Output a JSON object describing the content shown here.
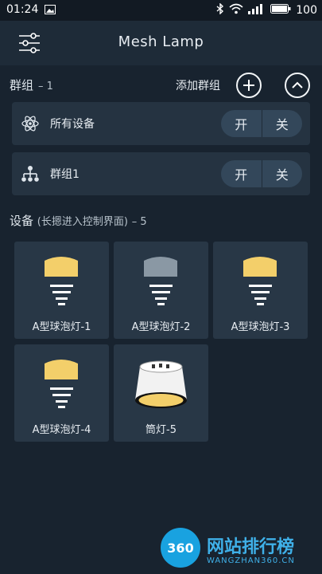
{
  "status_bar": {
    "time": "01:24",
    "battery": "100",
    "icons": [
      "image-icon",
      "bluetooth-icon",
      "wifi-icon",
      "signal-icon",
      "battery-icon"
    ]
  },
  "app_bar": {
    "title": "Mesh Lamp",
    "menu_icon": "sliders-menu-icon"
  },
  "groups": {
    "title": "群组",
    "count": "– 1",
    "add_label": "添加群组",
    "rows": [
      {
        "label": "所有设备",
        "icon": "atom-icon",
        "on": "开",
        "off": "关"
      },
      {
        "label": "群组1",
        "icon": "hierarchy-icon",
        "on": "开",
        "off": "关"
      }
    ]
  },
  "devices": {
    "title": "设备",
    "subtitle": "(长摁进入控制界面)",
    "count": "– 5",
    "items": [
      {
        "name": "A型球泡灯-1",
        "type": "bulb",
        "state": "on",
        "color": "#f3cf6a"
      },
      {
        "name": "A型球泡灯-2",
        "type": "bulb",
        "state": "off",
        "color": "#8a98a4"
      },
      {
        "name": "A型球泡灯-3",
        "type": "bulb",
        "state": "on",
        "color": "#f3cf6a"
      },
      {
        "name": "A型球泡灯-4",
        "type": "bulb",
        "state": "on",
        "color": "#f3cf6a"
      },
      {
        "name": "筒灯-5",
        "type": "downlight",
        "state": "on",
        "color": "#f3cf6a"
      }
    ]
  },
  "watermark": {
    "logo": "360",
    "title": "网站排行榜",
    "url": "WANGZHAN360.CN"
  },
  "colors": {
    "background": "#18232f",
    "card": "#253341",
    "accent_on": "#f3cf6a",
    "accent_off": "#8a98a4"
  }
}
